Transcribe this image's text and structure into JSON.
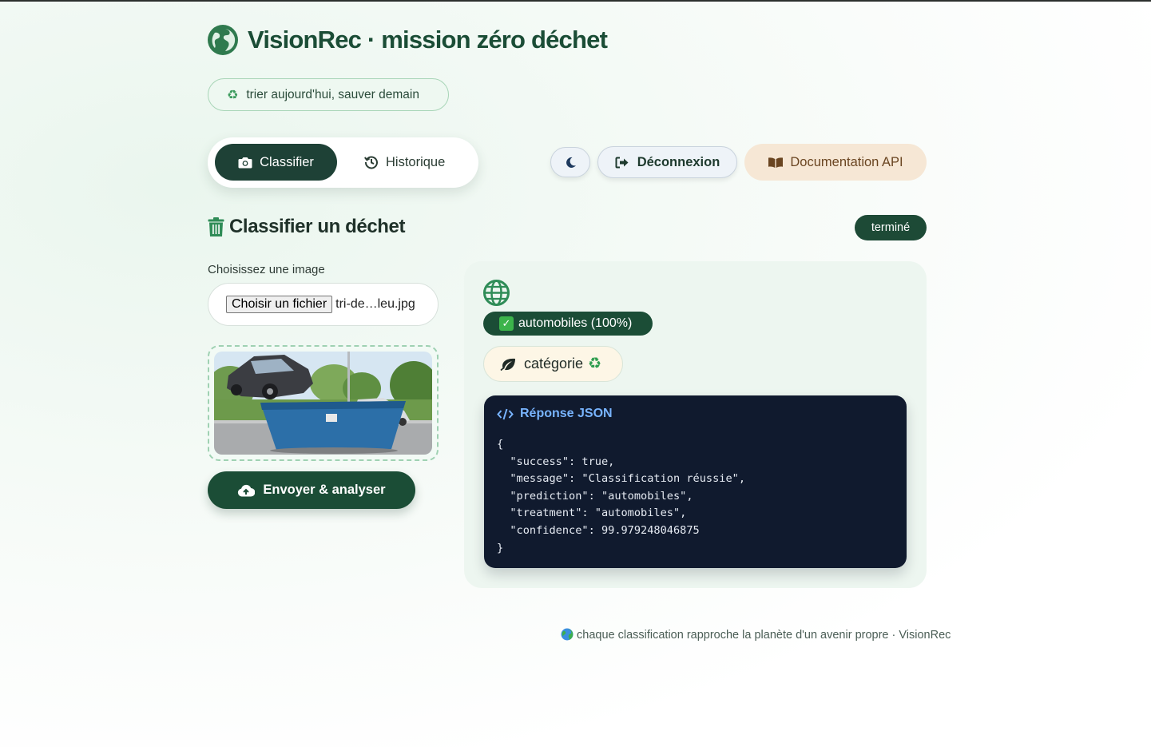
{
  "app": {
    "title": "VisionRec · mission zéro déchet",
    "tagline": "trier aujourd'hui, sauver demain"
  },
  "nav": {
    "tabs": [
      {
        "label": "Classifier",
        "active": true
      },
      {
        "label": "Historique",
        "active": false
      }
    ],
    "theme_toggle_icon": "moon-icon",
    "logout_label": "Déconnexion",
    "docs_label": "Documentation API"
  },
  "section": {
    "title": "Classifier un déchet",
    "status": "terminé"
  },
  "upload": {
    "label": "Choisissez une image",
    "button_label": "Choisir un fichier",
    "file_name": "tri-de…leu.jpg",
    "submit_label": "Envoyer & analyser"
  },
  "result": {
    "prediction_label": "automobiles (100%)",
    "category_label": "catégorie",
    "json_title": "Réponse JSON",
    "json_lines": [
      "{",
      "  \"success\": true,",
      "  \"message\": \"Classification réussie\",",
      "  \"prediction\": \"automobiles\",",
      "  \"treatment\": \"automobiles\",",
      "  \"confidence\": 99.979248046875",
      "}"
    ]
  },
  "footer": {
    "text": "chaque classification rapproche la planète d'un avenir propre · VisionRec"
  },
  "colors": {
    "brand": "#1b4d36",
    "accent_green": "#3a9a5c",
    "docs_bg": "#f6e7d5",
    "json_bg": "#101a2e"
  }
}
